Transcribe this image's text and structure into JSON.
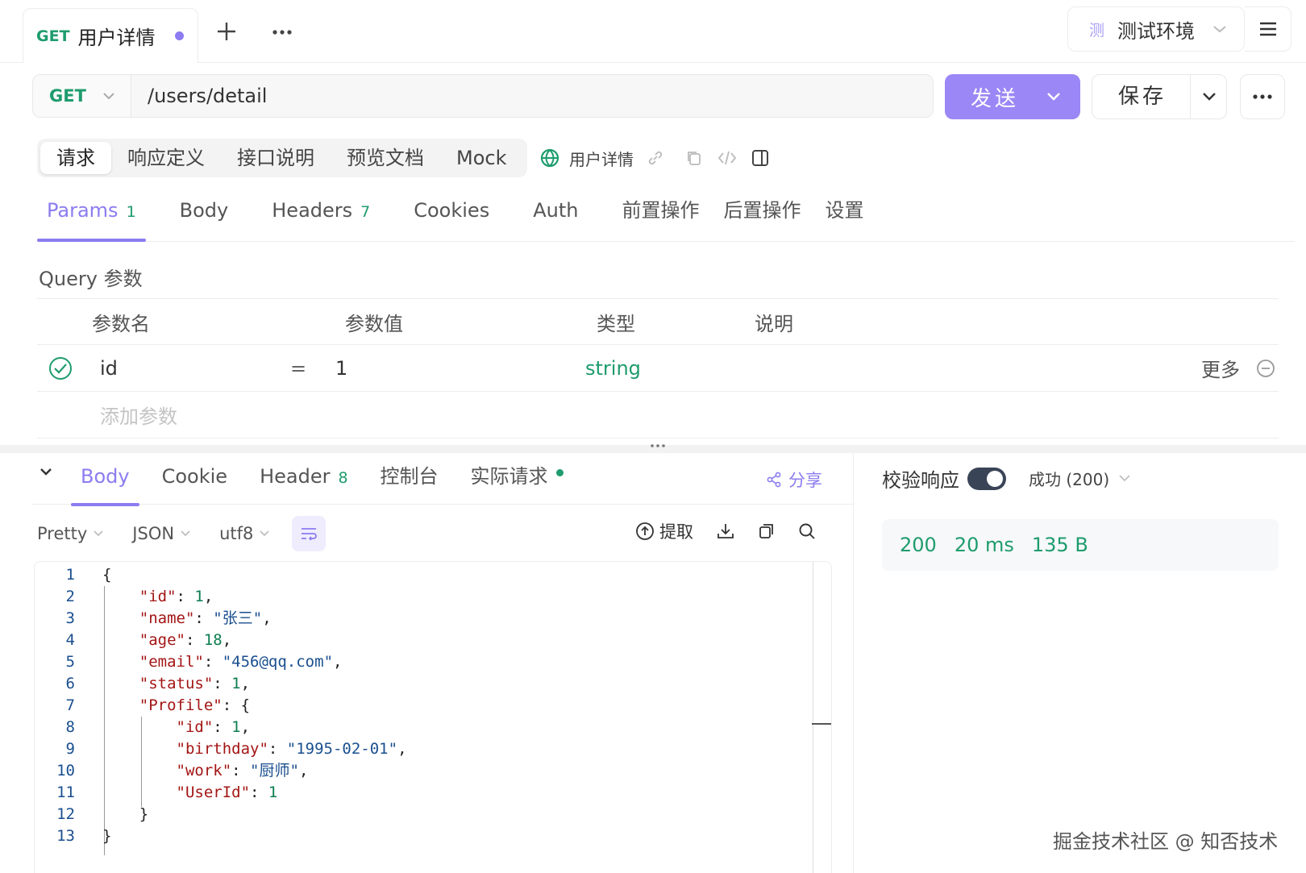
{
  "tab": {
    "method": "GET",
    "title": "用户详情"
  },
  "env": {
    "icon_char": "测",
    "label": "测试环境"
  },
  "request": {
    "method": "GET",
    "url": "/users/detail",
    "send_label": "发送",
    "save_label": "保存"
  },
  "doc_tabs": [
    "请求",
    "响应定义",
    "接口说明",
    "预览文档",
    "Mock"
  ],
  "doc_name": "用户详情",
  "req_tabs": [
    {
      "label": "Params",
      "count": "1"
    },
    {
      "label": "Body",
      "count": ""
    },
    {
      "label": "Headers",
      "count": "7"
    },
    {
      "label": "Cookies",
      "count": ""
    },
    {
      "label": "Auth",
      "count": ""
    },
    {
      "label": "前置操作",
      "count": ""
    },
    {
      "label": "后置操作",
      "count": ""
    },
    {
      "label": "设置",
      "count": ""
    }
  ],
  "query": {
    "title": "Query 参数",
    "headers": {
      "name": "参数名",
      "value": "参数值",
      "type": "类型",
      "desc": "说明"
    },
    "row": {
      "name": "id",
      "eq": "=",
      "value": "1",
      "type": "string",
      "more": "更多"
    },
    "add_placeholder": "添加参数"
  },
  "resp_tabs": [
    {
      "label": "Body",
      "count": ""
    },
    {
      "label": "Cookie",
      "count": ""
    },
    {
      "label": "Header",
      "count": "8"
    },
    {
      "label": "控制台",
      "count": ""
    },
    {
      "label": "实际请求",
      "count": ""
    }
  ],
  "share_label": "分享",
  "format": {
    "pretty": "Pretty",
    "lang": "JSON",
    "encoding": "utf8"
  },
  "tools": {
    "extract": "提取"
  },
  "code_lines": [
    "{",
    "  \"id\": 1,",
    "  \"name\": \"张三\",",
    "  \"age\": 18,",
    "  \"email\": \"456@qq.com\",",
    "  \"status\": 1,",
    "  \"Profile\": {",
    "    \"id\": 1,",
    "    \"birthday\": \"1995-02-01\",",
    "    \"work\": \"厨师\",",
    "    \"UserId\": 1",
    "  }",
    "}"
  ],
  "validate": {
    "label": "校验响应",
    "status": "成功 (200)"
  },
  "stats": {
    "code": "200",
    "time": "20 ms",
    "size": "135 B"
  },
  "watermark": "掘金技术社区 @ 知否技术",
  "colors": {
    "accent": "#9b87f5",
    "green": "#1e9c6d"
  }
}
